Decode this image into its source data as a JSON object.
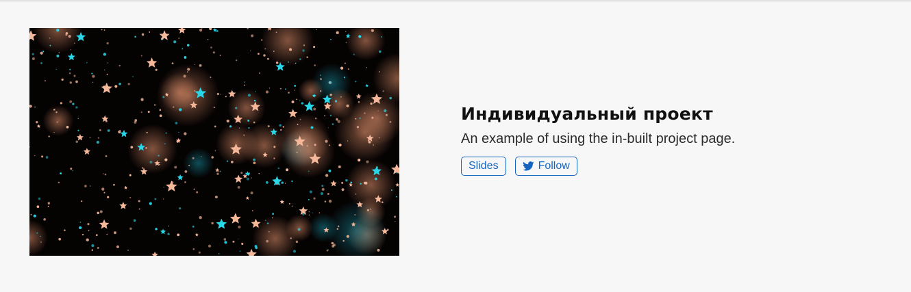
{
  "project": {
    "title": "Индивидуальный проект",
    "summary": "An example of using the in-built project page.",
    "image_icon": "starfield-image",
    "links": [
      {
        "label": "Slides",
        "icon": ""
      },
      {
        "label": "Follow",
        "icon": "twitter-icon"
      }
    ]
  },
  "colors": {
    "background": "#f7f7f7",
    "link": "#1565c0",
    "image_background": "#050202",
    "star_peach": "#f5b89a",
    "star_cyan": "#28d8e8"
  }
}
